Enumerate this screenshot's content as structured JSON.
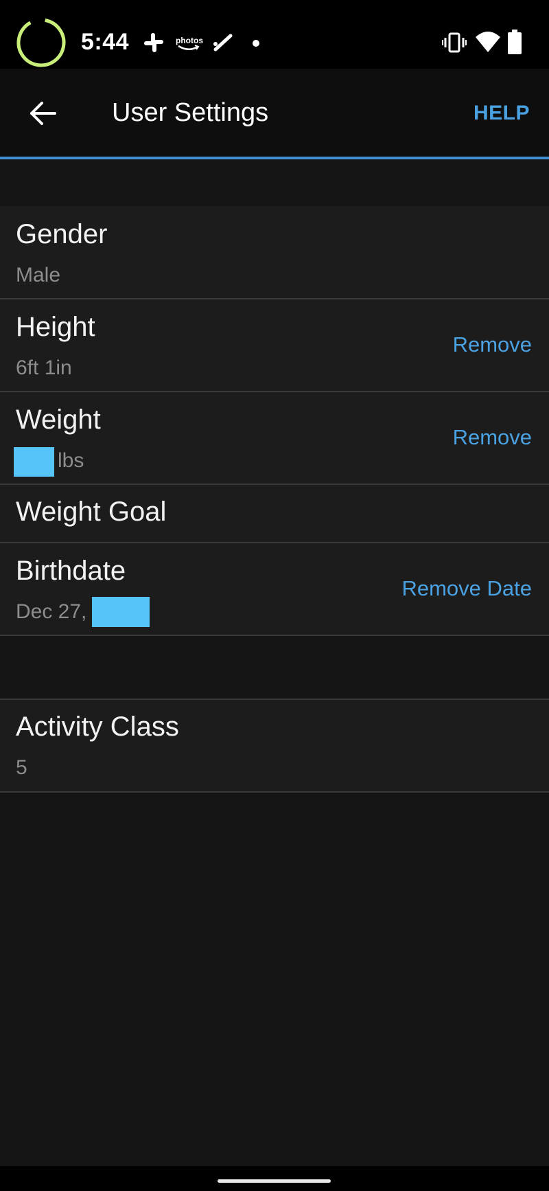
{
  "status_bar": {
    "time": "5:44",
    "photos_label": "photos",
    "icons": [
      "loading-ring-icon",
      "slack-icon",
      "amazon-photos-icon",
      "pen-icon",
      "dot-icon",
      "vibrate-icon",
      "wifi-icon",
      "battery-icon"
    ]
  },
  "header": {
    "title": "User Settings",
    "help_label": "HELP",
    "accent_color": "#4aa2e2"
  },
  "settings": {
    "gender": {
      "label": "Gender",
      "value": "Male"
    },
    "height": {
      "label": "Height",
      "value": "6ft 1in",
      "action": "Remove"
    },
    "weight": {
      "label": "Weight",
      "unit": "lbs",
      "action": "Remove"
    },
    "weight_goal": {
      "label": "Weight Goal"
    },
    "birthdate": {
      "label": "Birthdate",
      "value": "Dec 27,",
      "action": "Remove Date"
    },
    "activity_class": {
      "label": "Activity Class",
      "value": "5"
    }
  }
}
